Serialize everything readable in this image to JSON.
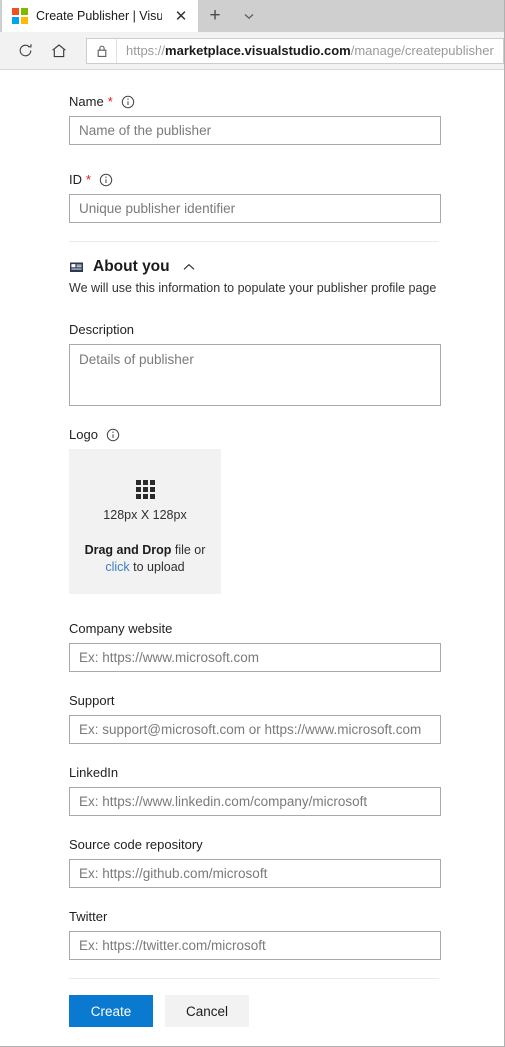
{
  "browser": {
    "tab": {
      "title": "Create Publisher | Visua",
      "favicon": "microsoft-logo-icon",
      "close_label": "✕"
    },
    "new_tab_label": "+",
    "tab_list_icon": "chevron-down-icon",
    "toolbar": {
      "reload_icon": "reload-icon",
      "home_icon": "home-icon",
      "lock_icon": "lock-icon",
      "url_scheme": "https://",
      "url_domain": "marketplace.visualstudio.com",
      "url_path": "/manage/createpublisher"
    }
  },
  "form": {
    "name": {
      "label": "Name",
      "required_mark": "*",
      "info_icon": "info-icon",
      "placeholder": "Name of the publisher",
      "value": ""
    },
    "id": {
      "label": "ID",
      "required_mark": "*",
      "info_icon": "info-icon",
      "placeholder": "Unique publisher identifier",
      "value": ""
    },
    "about_section": {
      "icon": "contact-card-icon",
      "title": "About you",
      "collapse_icon": "chevron-up-icon",
      "subtitle": "We will use this information to populate your publisher profile page"
    },
    "description": {
      "label": "Description",
      "placeholder": "Details of publisher",
      "value": ""
    },
    "logo": {
      "label": "Logo",
      "info_icon": "info-icon",
      "grid_icon": "grid-icon",
      "size_text": "128px X 128px",
      "drag_bold": "Drag and Drop",
      "drag_rest": " file or",
      "click_link": "click",
      "click_rest": " to upload"
    },
    "company_website": {
      "label": "Company website",
      "placeholder": "Ex: https://www.microsoft.com",
      "value": ""
    },
    "support": {
      "label": "Support",
      "placeholder": "Ex: support@microsoft.com or https://www.microsoft.com",
      "value": ""
    },
    "linkedin": {
      "label": "LinkedIn",
      "placeholder": "Ex: https://www.linkedin.com/company/microsoft",
      "value": ""
    },
    "source_code": {
      "label": "Source code repository",
      "placeholder": "Ex: https://github.com/microsoft",
      "value": ""
    },
    "twitter": {
      "label": "Twitter",
      "placeholder": "Ex: https://twitter.com/microsoft",
      "value": ""
    },
    "actions": {
      "create_label": "Create",
      "cancel_label": "Cancel"
    }
  },
  "colors": {
    "primary": "#0a7ad1",
    "required": "#e81123",
    "link": "#3b7fc4",
    "dropzone_bg": "#f2f2f2"
  }
}
